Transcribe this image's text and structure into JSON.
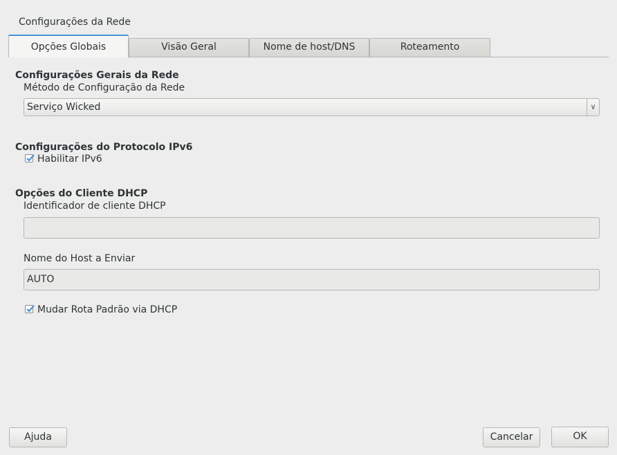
{
  "window": {
    "title": "Configurações da Rede"
  },
  "tabs": [
    {
      "label": "Opções Globais",
      "active": true
    },
    {
      "label": "Visão Geral",
      "active": false
    },
    {
      "label": "Nome de host/DNS",
      "active": false
    },
    {
      "label": "Roteamento",
      "active": false
    }
  ],
  "general": {
    "heading": "Configurações Gerais da Rede",
    "method_label": "Método de Configuração da Rede",
    "method_value": "Serviço Wicked"
  },
  "ipv6": {
    "heading": "Configurações do Protocolo IPv6",
    "enable_label": "Habilitar IPv6",
    "enable_checked": true
  },
  "dhcp": {
    "heading": "Opções do Cliente DHCP",
    "client_id_label": "Identificador de cliente DHCP",
    "client_id_value": "",
    "hostname_label": "Nome do Host a Enviar",
    "hostname_value": "AUTO",
    "default_route_label": "Mudar Rota Padrão via DHCP",
    "default_route_checked": true
  },
  "buttons": {
    "help": "Ajuda",
    "cancel": "Cancelar",
    "ok": "OK"
  },
  "colors": {
    "accent": "#4a90d9",
    "background": "#ededed"
  }
}
